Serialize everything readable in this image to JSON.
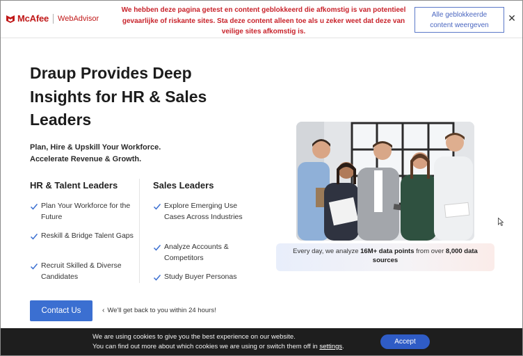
{
  "mcafee": {
    "brand": "McAfee",
    "product": "WebAdvisor",
    "message": "We hebben deze pagina getest en content geblokkeerd die afkomstig is van potentieel gevaarlijke of riskante sites. Sta deze content alleen toe als u zeker weet dat deze van veilige sites afkomstig is.",
    "show_all_label": "Alle geblokkeerde content weergeven",
    "close_label": "✕",
    "brand_color": "#c01818"
  },
  "hero": {
    "title": "Draup Provides Deep Insights for HR & Sales Leaders",
    "subtitle_line1": "Plan, Hire & Upskill Your Workforce.",
    "subtitle_line2": "Accelerate Revenue & Growth."
  },
  "hr": {
    "heading": "HR & Talent Leaders",
    "items": [
      "Plan Your Workforce for the Future",
      "Reskill & Bridge Talent Gaps",
      "Recruit Skilled & Diverse Candidates"
    ]
  },
  "sales": {
    "heading": "Sales Leaders",
    "items": [
      "Explore Emerging Use Cases Across Industries",
      "Analyze Accounts & Competitors",
      "Study Buyer Personas"
    ]
  },
  "cta": {
    "contact_label": "Contact Us",
    "callback_arrow": "‹",
    "callback_text": "We'll get back to you within 24 hours!"
  },
  "info_card": {
    "prefix": "Every day, we analyze ",
    "points": "16M+ data points",
    "middle": " from over ",
    "sources": "8,000 data sources"
  },
  "cookie": {
    "line1": "We are using cookies to give you the best experience on our website.",
    "line2_prefix": "You can find out more about which cookies we are using or switch them off in ",
    "settings_link": "settings",
    "line2_suffix": ".",
    "accept_label": "Accept"
  },
  "colors": {
    "accent": "#3b6fd1",
    "check": "#3b6fd1",
    "cookie_bg": "#1e1e1e"
  }
}
